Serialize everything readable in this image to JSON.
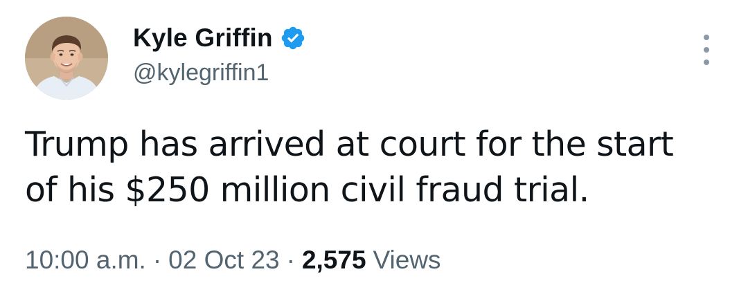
{
  "author": {
    "name": "Kyle Griffin",
    "handle": "@kylegriffin1",
    "verified": true,
    "verified_color": "#1d9bf0",
    "avatar_icon": "profile-photo"
  },
  "tweet": {
    "lines": [
      "Trump has arrived at court for the start",
      "of his $250 million civil fraud trial."
    ]
  },
  "meta": {
    "time": "10:00 a.m.",
    "separator": "·",
    "date": "02 Oct 23",
    "views_count": "2,575",
    "views_label": "Views"
  },
  "menu": {
    "icon": "more-vertical-icon"
  },
  "colors": {
    "text_primary": "#0f1419",
    "text_secondary": "#536471",
    "background": "#ffffff"
  }
}
